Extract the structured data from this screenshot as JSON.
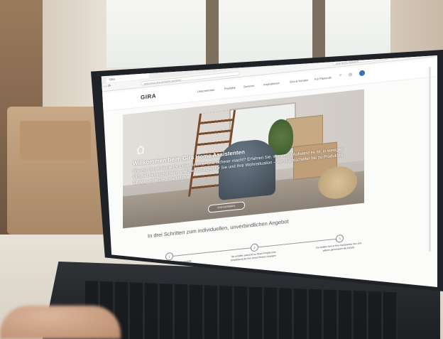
{
  "browser": {
    "tab_title": "Gira",
    "url": "www.shop.gira.de/home-assistent",
    "search_placeholder": "Gira Home Assistent"
  },
  "site": {
    "logo": "GIRA",
    "nav_items": [
      "Unternehmen",
      "Produkte",
      "Services",
      "Inspirationen",
      "Gira & Kunden"
    ],
    "partner_label": "Für Planende"
  },
  "hero": {
    "title": "Willkommen beim Gira Home Assistenten",
    "body": "Wie ein Smart Home Ihr Leben leichter und sicherer macht? Erfahren Sie, wie wenig Aufwand es ist, in wenigen Minuten herauszufinden, welche Lösungen für Sie und Ihre Wohnsituation – vom Lichtschalter bis zu Produkten für das vernetzte Smart Home.",
    "button": "ZUR AUSWAHL"
  },
  "steps": {
    "subtitle": "In drei Schritten zum individuellen, unverbindlichen Angebot",
    "items": [
      {
        "num": "1",
        "text": "Sie beantworten Fragen zu Ihrem Neuprojekt, Ihren Wünschen und Anforderungen"
      },
      {
        "num": "2",
        "text": "Sie erhalten passend zu Ihrem Projekt eine Empfehlung für Ihre Smart Home Lösungen"
      },
      {
        "num": "3",
        "text": "Sie wählen Ihre in Ihre Fachpartner aus und planen gemeinsam die Details"
      }
    ]
  }
}
